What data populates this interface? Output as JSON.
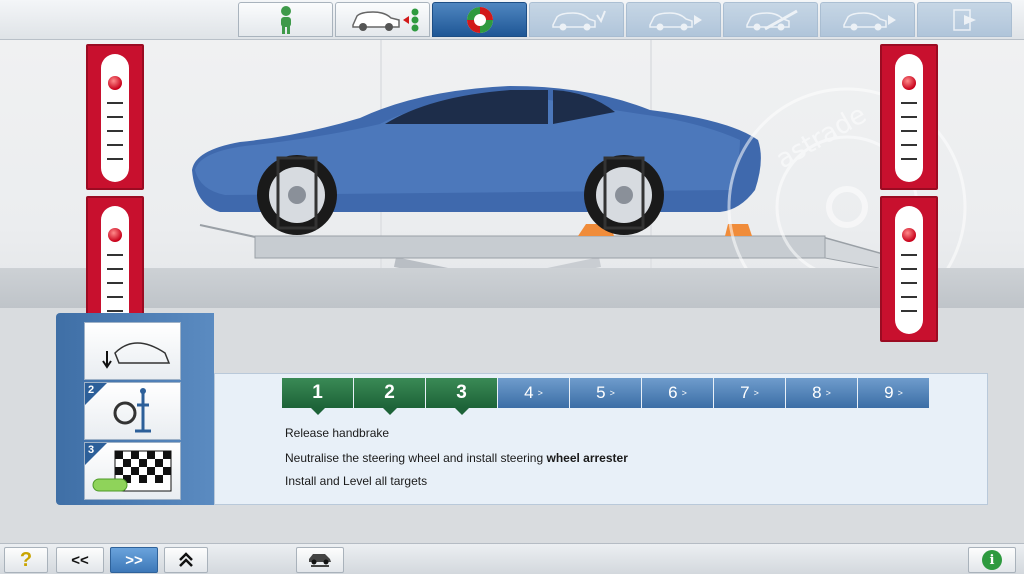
{
  "tabs": [
    {
      "name": "customer",
      "icon": "person-icon",
      "state": "normal"
    },
    {
      "name": "vehicle-check",
      "icon": "car-check-icon",
      "state": "normal"
    },
    {
      "name": "alignment",
      "icon": "target-icon",
      "state": "active"
    },
    {
      "name": "tab-4",
      "icon": "car-check-icon",
      "state": "disabled"
    },
    {
      "name": "tab-5",
      "icon": "car-play-icon",
      "state": "disabled"
    },
    {
      "name": "tab-6",
      "icon": "car-wrench-icon",
      "state": "disabled"
    },
    {
      "name": "tab-7",
      "icon": "car-play-icon",
      "state": "disabled"
    },
    {
      "name": "tab-8",
      "icon": "export-icon",
      "state": "disabled"
    }
  ],
  "watermark": {
    "text": "astrade"
  },
  "gauges": {
    "left_top": {
      "level": 0.0
    },
    "left_bottom": {
      "level": 0.0
    },
    "right_top": {
      "level": 0.0
    },
    "right_bottom": {
      "level": 0.0
    }
  },
  "step_panel": {
    "thumbs": [
      {
        "number": "",
        "icon": "handbrake-icon"
      },
      {
        "number": "2",
        "icon": "steering-wheel-arrester-icon"
      },
      {
        "number": "3",
        "icon": "checkered-target-icon"
      }
    ]
  },
  "steps": [
    {
      "label": "1",
      "state": "done"
    },
    {
      "label": "2",
      "state": "done"
    },
    {
      "label": "3",
      "state": "current"
    },
    {
      "label": "4",
      "state": "todo"
    },
    {
      "label": "5",
      "state": "todo"
    },
    {
      "label": "6",
      "state": "todo"
    },
    {
      "label": "7",
      "state": "todo"
    },
    {
      "label": "8",
      "state": "todo"
    },
    {
      "label": "9",
      "state": "todo"
    }
  ],
  "instructions": {
    "line1": "Release handbrake",
    "line2_prefix": "Neutralise the steering wheel and install steering ",
    "line2_bold": "wheel arrester",
    "line3": "Install and Level all targets"
  },
  "bottom": {
    "help": "?",
    "prev": "<<",
    "next": ">>",
    "up": "⌃⌃",
    "lift_icon": "car-lift-icon",
    "info": "i"
  },
  "colors": {
    "accent_blue": "#2c5f99",
    "done_green": "#1d6338",
    "gauge_red": "#c8102e"
  }
}
